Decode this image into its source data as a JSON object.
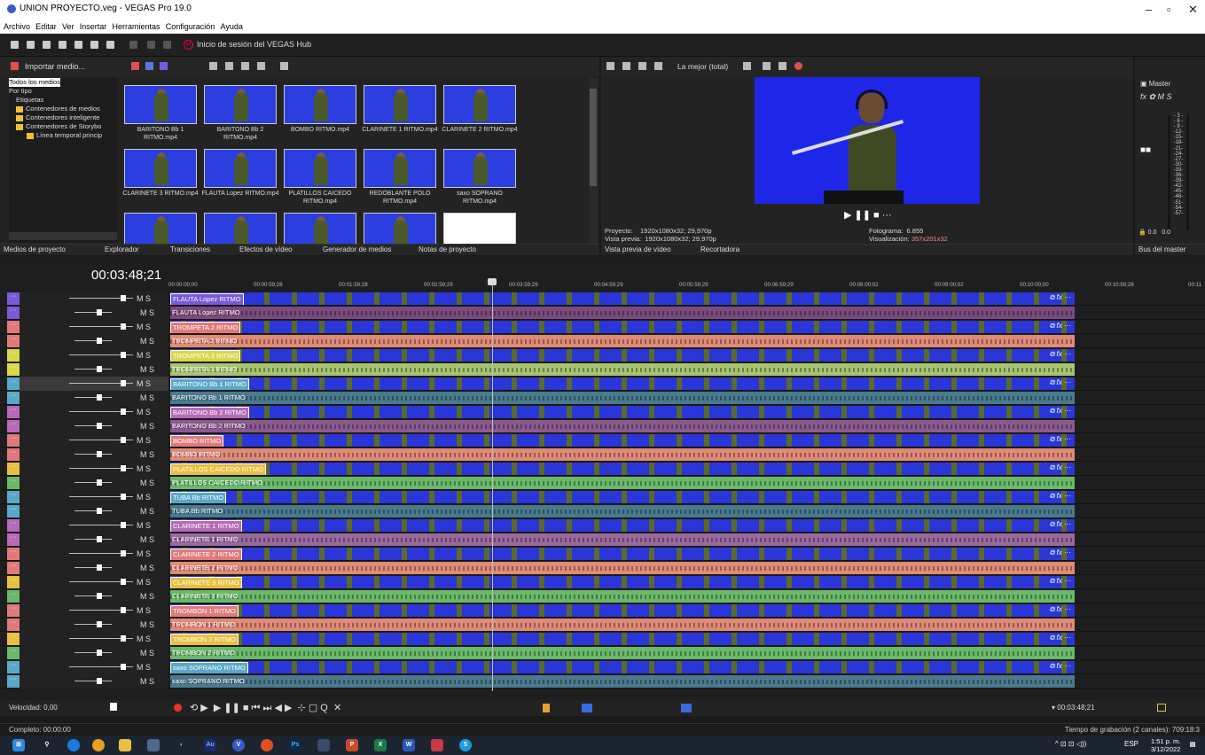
{
  "window": {
    "title": "UNION PROYECTO.veg - VEGAS Pro 19.0"
  },
  "menu": [
    "Archivo",
    "Editar",
    "Ver",
    "Insertar",
    "Herramientas",
    "Configuración",
    "Ayuda"
  ],
  "toolbar": {
    "hub_label": "Inicio de sesión del VEGAS Hub"
  },
  "media": {
    "import_label": "Importar medio...",
    "tree": [
      "Todos los medios",
      "Por tipo",
      "Etiquetas",
      "Contenedores de medios",
      "Contenedores inteligente",
      "Contenedores de Storybo",
      "Línea temporal princip"
    ],
    "thumbs": [
      "BARITONO Bb 1 RITMO.mp4",
      "BARITONO Bb 2 RITMO.mp4",
      "BOMBO RITMO.mp4",
      "CLARINETE 1 RITMO.mp4",
      "CLARINETE 2 RITMO.mp4",
      "CLARINETE 3 RITMO.mp4",
      "FLAUTA Lopez RITMO.mp4",
      "PLATILLOS CAICEDO RITMO.mp4",
      "REDOBLANTE POLO RITMO.mp4",
      "saxo SOPRANO RITMO.mp4"
    ],
    "tabs": [
      "Medios de proyecto",
      "Explorador",
      "Transiciones",
      "Efectos de vídeo",
      "Generador de medios",
      "Notas de proyecto"
    ]
  },
  "preview": {
    "quality": "La mejor (total)",
    "project": "Proyecto:    1920x1080x32; 29,970p",
    "vista": "Vista previa:  1920x1080x32; 29,970p",
    "frame": "Fotograma:  6.855",
    "display_label": "Visualización:",
    "display_value": "357x201x32",
    "tabs": [
      "Vista previa de vídeo",
      "Recortadora"
    ]
  },
  "master": {
    "label": "Master",
    "scale": "- 3 -\n- 6 -\n- 9 -\n-12-\n-15-\n-18-\n-21-\n-24-\n-27-\n-30-\n-33-\n-36-\n-39-\n-42-\n-45-\n-48-\n-51-\n-54-\n-57-",
    "vals": "0.0   0.0",
    "tab": "Bus del master"
  },
  "timeline": {
    "timecode": "00:03:48;21",
    "ruler": [
      "00:00:00;00",
      "00:00:59;28",
      "00:01:59;28",
      "00:02:59;29",
      "00:03:59;29",
      "00:04:59;29",
      "00:05:59;29",
      "00:06:59;29",
      "00:08:00;02",
      "00:09:00;02",
      "00:10:00;00",
      "00:10:59;28",
      "00:11"
    ],
    "tracks": [
      {
        "name": "FLAUTA Lopez RITMO",
        "kind": "video",
        "color": "#7a5ad8",
        "clip": "#2a36d8"
      },
      {
        "name": "FLAUTA Lopez RITMO",
        "kind": "audio",
        "color": "#7a5ad8",
        "clip": "#7c4a7e"
      },
      {
        "name": "TROMPETA 2 RITMO",
        "kind": "video",
        "color": "#e07a7a",
        "clip": "#2a36d8"
      },
      {
        "name": "TROMPETA 2 RITMO",
        "kind": "audio",
        "color": "#e07a7a",
        "clip": "#e08a78"
      },
      {
        "name": "TROMPETA 3 RITMO",
        "kind": "video",
        "color": "#d8d84a",
        "clip": "#2a36d8"
      },
      {
        "name": "TROMPETA 3 RITMO",
        "kind": "audio",
        "color": "#d8d84a",
        "clip": "#a8c470"
      },
      {
        "name": "BARITONO Bb 1 RITMO",
        "kind": "video",
        "color": "#5aa8c8",
        "clip": "#2a36d8"
      },
      {
        "name": "BARITONO Bb 1 RITMO",
        "kind": "audio",
        "color": "#5aa8c8",
        "clip": "#4a7a8e"
      },
      {
        "name": "BARITONO Bb 2 RITMO",
        "kind": "video",
        "color": "#b86ab8",
        "clip": "#2a36d8"
      },
      {
        "name": "BARITONO Bb 2 RITMO",
        "kind": "audio",
        "color": "#b86ab8",
        "clip": "#8a5a8e"
      },
      {
        "name": "BOMBO RITMO",
        "kind": "video",
        "color": "#e07a7a",
        "clip": "#2a36d8"
      },
      {
        "name": "BOMBO RITMO",
        "kind": "audio",
        "color": "#e07a7a",
        "clip": "#e08a78"
      },
      {
        "name": "PLATILLOS CAICEDO RITMO",
        "kind": "video",
        "color": "#e8c040",
        "clip": "#2a36d8"
      },
      {
        "name": "PLATILLOS CAICEDO RITMO",
        "kind": "audio",
        "color": "#6ab86a",
        "clip": "#6ab86a"
      },
      {
        "name": "TUBA Bb RITMO",
        "kind": "video",
        "color": "#5aa8c8",
        "clip": "#2a36d8"
      },
      {
        "name": "TUBA Bb RITMO",
        "kind": "audio",
        "color": "#5aa8c8",
        "clip": "#4a7a8e"
      },
      {
        "name": "CLARINETE 1 RITMO",
        "kind": "video",
        "color": "#b86ab8",
        "clip": "#2a36d8"
      },
      {
        "name": "CLARINETE 1 RITMO",
        "kind": "audio",
        "color": "#b86ab8",
        "clip": "#9a6a9e"
      },
      {
        "name": "CLARINETE 2 RITMO",
        "kind": "video",
        "color": "#e07a7a",
        "clip": "#2a36d8"
      },
      {
        "name": "CLARINETE 2 RITMO",
        "kind": "audio",
        "color": "#e07a7a",
        "clip": "#e08a78"
      },
      {
        "name": "CLARINETE 3 RITMO",
        "kind": "video",
        "color": "#e8c040",
        "clip": "#2a36d8"
      },
      {
        "name": "CLARINETE 3 RITMO",
        "kind": "audio",
        "color": "#6ab86a",
        "clip": "#6ab86a"
      },
      {
        "name": "TROMBON 1 RITMO",
        "kind": "video",
        "color": "#e07a7a",
        "clip": "#2a36d8"
      },
      {
        "name": "TROMBON 1 RITMO",
        "kind": "audio",
        "color": "#e07a7a",
        "clip": "#e08a78"
      },
      {
        "name": "TROMBON 2 RITMO",
        "kind": "video",
        "color": "#e8c040",
        "clip": "#2a36d8"
      },
      {
        "name": "TROMBON 2 RITMO",
        "kind": "audio",
        "color": "#6ab86a",
        "clip": "#6ab86a"
      },
      {
        "name": "saxo SOPRANO RITMO",
        "kind": "video",
        "color": "#5aa8c8",
        "clip": "#2a36d8"
      },
      {
        "name": "saxo SOPRANO RITMO",
        "kind": "audio",
        "color": "#5aa8c8",
        "clip": "#4a7a8e"
      }
    ],
    "speed": "Velocidad: 0,00",
    "end_time": "00:03:48;21"
  },
  "status": {
    "left": "Completo: 00:00:00",
    "right": "Tiempo de grabación (2 canales): 709:18:3"
  },
  "taskbar": {
    "lang": "ESP",
    "time": "1:51 p. m.",
    "date": "3/12/2022"
  }
}
